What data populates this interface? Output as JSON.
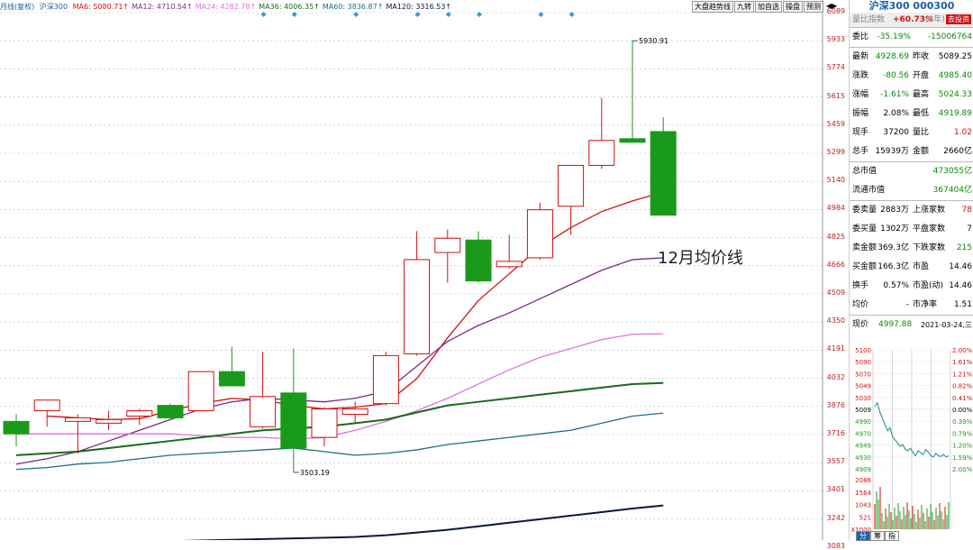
{
  "ma_bar": {
    "period": "月线(复权)",
    "name": "沪深300",
    "items": [
      {
        "label": "MA6: 5080.71↑",
        "color": "#d01010"
      },
      {
        "label": "MA12: 4710.54↑",
        "color": "#7a2a8a"
      },
      {
        "label": "MA24: 4282.78↑",
        "color": "#e070e0"
      },
      {
        "label": "MA36: 4006.35↑",
        "color": "#1a6a1a"
      },
      {
        "label": "MA60: 3836.87↑",
        "color": "#207080"
      },
      {
        "label": "MA120: 3316.53↑",
        "color": "#0a1a3a"
      }
    ]
  },
  "toolbar": [
    "大盘趋势线",
    "九转",
    "加自选",
    "操盘",
    "预测"
  ],
  "annotation": "12月均价线",
  "price_axis": [
    "6089",
    "5933",
    "5774",
    "5615",
    "5459",
    "5299",
    "5140",
    "4984",
    "4825",
    "4666",
    "4509",
    "4350",
    "4191",
    "4032",
    "3876",
    "3716",
    "3557",
    "3401",
    "3242",
    "3083"
  ],
  "high_label": "5930.91",
  "low_label": "3503.19",
  "chart_data": {
    "type": "candlestick",
    "candles": [
      {
        "o": 3790,
        "c": 3720,
        "h": 3830,
        "l": 3650
      },
      {
        "o": 3850,
        "c": 3910,
        "h": 3910,
        "l": 3760
      },
      {
        "o": 3790,
        "c": 3810,
        "h": 3830,
        "l": 3610
      },
      {
        "o": 3780,
        "c": 3800,
        "h": 3850,
        "l": 3740
      },
      {
        "o": 3820,
        "c": 3850,
        "h": 3860,
        "l": 3770
      },
      {
        "o": 3880,
        "c": 3810,
        "h": 3890,
        "l": 3800
      },
      {
        "o": 3850,
        "c": 4070,
        "h": 4070,
        "l": 3850
      },
      {
        "o": 4070,
        "c": 3990,
        "h": 4210,
        "l": 3990
      },
      {
        "o": 3760,
        "c": 3930,
        "h": 4180,
        "l": 3750
      },
      {
        "o": 3950,
        "c": 3640,
        "h": 4200,
        "l": 3503.19
      },
      {
        "o": 3700,
        "c": 3860,
        "h": 3870,
        "l": 3650
      },
      {
        "o": 3830,
        "c": 3860,
        "h": 3900,
        "l": 3780
      },
      {
        "o": 3890,
        "c": 4160,
        "h": 4180,
        "l": 3880
      },
      {
        "o": 4170,
        "c": 4700,
        "h": 4860,
        "l": 4160
      },
      {
        "o": 4740,
        "c": 4820,
        "h": 4870,
        "l": 4570
      },
      {
        "o": 4810,
        "c": 4580,
        "h": 4860,
        "l": 4570
      },
      {
        "o": 4660,
        "c": 4690,
        "h": 4840,
        "l": 4650
      },
      {
        "o": 4710,
        "c": 4980,
        "h": 5020,
        "l": 4700
      },
      {
        "o": 5000,
        "c": 5230,
        "h": 5230,
        "l": 4840
      },
      {
        "o": 5230,
        "c": 5370,
        "h": 5610,
        "l": 5210
      },
      {
        "o": 5380,
        "c": 5360,
        "h": 5930.91,
        "l": 5360
      },
      {
        "o": 5420,
        "c": 4950,
        "h": 5500,
        "l": 4950
      }
    ],
    "ma": [
      {
        "name": "MA6",
        "color": "#d01010",
        "values": [
          null,
          3820,
          3810,
          3800,
          3805,
          3850,
          3890,
          3920,
          3910,
          3880,
          3860,
          3870,
          3890,
          4030,
          4260,
          4470,
          4620,
          4770,
          4880,
          4970,
          5030,
          5080
        ]
      },
      {
        "name": "MA12",
        "color": "#7a2a8a",
        "values": [
          3550,
          3580,
          3620,
          3680,
          3740,
          3800,
          3860,
          3900,
          3920,
          3910,
          3900,
          3920,
          3960,
          4100,
          4240,
          4330,
          4400,
          4480,
          4560,
          4640,
          4700,
          4710
        ]
      },
      {
        "name": "MA24",
        "color": "#e070e0",
        "values": [
          3720,
          3720,
          3720,
          3720,
          3720,
          3720,
          3710,
          3700,
          3700,
          3690,
          3700,
          3740,
          3790,
          3850,
          3920,
          4000,
          4080,
          4150,
          4200,
          4250,
          4280,
          4283
        ]
      },
      {
        "name": "MA36",
        "color": "#1a6a1a",
        "values": [
          3600,
          3610,
          3620,
          3640,
          3660,
          3680,
          3700,
          3720,
          3740,
          3750,
          3760,
          3780,
          3800,
          3840,
          3880,
          3900,
          3920,
          3940,
          3960,
          3980,
          4000,
          4006
        ]
      },
      {
        "name": "MA60",
        "color": "#207080",
        "values": [
          3520,
          3530,
          3550,
          3560,
          3580,
          3600,
          3610,
          3620,
          3630,
          3640,
          3620,
          3600,
          3610,
          3630,
          3660,
          3680,
          3700,
          3720,
          3740,
          3780,
          3820,
          3837
        ]
      },
      {
        "name": "MA120",
        "color": "#0a1a3a",
        "values": [
          3100,
          3100,
          3105,
          3108,
          3112,
          3116,
          3120,
          3124,
          3128,
          3132,
          3136,
          3140,
          3150,
          3165,
          3180,
          3200,
          3220,
          3240,
          3260,
          3280,
          3300,
          3317
        ]
      }
    ],
    "ylim": [
      3000,
      6089
    ]
  },
  "panel": {
    "title": "沪深300 000300",
    "ratio_label": "量比指数",
    "ratio_value": "+60.73%",
    "ratio_note": "(3年)",
    "ratio_btn": "去投资",
    "committee": {
      "label": "委比",
      "v1": "-35.19%",
      "v2": "-15006764"
    },
    "rows": [
      {
        "l1": "最新",
        "v1": "4928.69",
        "c1": "green",
        "l2": "昨收",
        "v2": "5089.25",
        "c2": "blk"
      },
      {
        "l1": "涨跌",
        "v1": "-80.56",
        "c1": "green",
        "l2": "开盘",
        "v2": "4985.40",
        "c2": "green"
      },
      {
        "l1": "涨幅",
        "v1": "-1.61%",
        "c1": "green",
        "l2": "最高",
        "v2": "5024.33",
        "c2": "green"
      },
      {
        "l1": "振幅",
        "v1": "2.08%",
        "c1": "blk",
        "l2": "最低",
        "v2": "4919.89",
        "c2": "green"
      },
      {
        "l1": "现手",
        "v1": "37200",
        "c1": "blk",
        "l2": "量比",
        "v2": "1.02",
        "c2": "red"
      },
      {
        "l1": "总手",
        "v1": "15939万",
        "c1": "blk",
        "l2": "金额",
        "v2": "2660亿",
        "c2": "blk"
      }
    ],
    "caps": [
      {
        "l": "总市值",
        "v": "473055亿"
      },
      {
        "l": "流通市值",
        "v": "367404亿"
      }
    ],
    "flow": [
      {
        "l1": "委卖量",
        "v1": "2883万",
        "c1": "blk",
        "l2": "上涨家数",
        "v2": "78",
        "c2": "red"
      },
      {
        "l1": "委买量",
        "v1": "1302万",
        "c1": "blk",
        "l2": "平盘家数",
        "v2": "7",
        "c2": "blk"
      },
      {
        "l1": "卖金额",
        "v1": "369.3亿",
        "c1": "blk",
        "l2": "下跌家数",
        "v2": "215",
        "c2": "green"
      },
      {
        "l1": "买金额",
        "v1": "166.3亿",
        "c1": "blk",
        "l2": "市盈",
        "v2": "14.46",
        "c2": "blk"
      },
      {
        "l1": "换手",
        "v1": "0.57%",
        "c1": "blk",
        "l2": "市盈(动)",
        "v2": "14.46",
        "c2": "blk"
      },
      {
        "l1": "均价",
        "v1": "-",
        "c1": "blk",
        "l2": "市净率",
        "v2": "1.51",
        "c2": "blk"
      }
    ],
    "now_label": "现价",
    "now_value": "4997.88",
    "date": "2021-03-24,三",
    "mini_left": [
      "5100",
      "5090",
      "5070",
      "5049",
      "5030",
      "5009",
      "4990",
      "4970",
      "4949",
      "4930",
      "4909"
    ],
    "mini_right": [
      "2.00%",
      "1.61%",
      "1.21%",
      "0.82%",
      "0.41%",
      "0.00%",
      "0.39%",
      "0.79%",
      "1.20%",
      "1.59%",
      "2.00%"
    ],
    "vol_left": [
      "2086",
      "1564",
      "1043",
      "521",
      "X1000"
    ]
  },
  "tabs": [
    "分",
    "筹",
    "指"
  ]
}
